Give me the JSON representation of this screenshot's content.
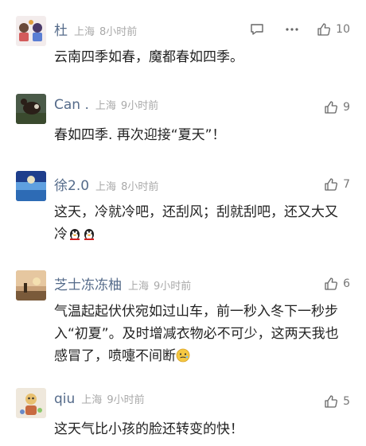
{
  "comments": [
    {
      "name": "杜",
      "location": "上海",
      "time": "8小时前",
      "likes": "10",
      "text": "云南四季如春，魔都春如四季。",
      "show_reply": true,
      "show_more": true
    },
    {
      "name": "Can .",
      "location": "上海",
      "time": "9小时前",
      "likes": "9",
      "text": "春如四季. 再次迎接“夏天”！"
    },
    {
      "name": "徐2.0",
      "location": "上海",
      "time": "8小时前",
      "likes": "7",
      "text": "这天，冷就冷吧，还刮风；刮就刮吧，还又大又冷"
    },
    {
      "name": "芝士冻冻柚",
      "location": "上海",
      "time": "9小时前",
      "likes": "6",
      "text": "气温起起伏伏宛如过山车，前一秒入冬下一秒步入“初夏”。及时增减衣物必不可少，这两天我也感冒了，喷嚏不间断"
    },
    {
      "name": "qiu",
      "location": "上海",
      "time": "9小时前",
      "likes": "5",
      "text": "这天气比小孩的脸还转变的快！"
    }
  ],
  "icons": {
    "reply": "comment-bubble-icon",
    "more": "more-dots-icon",
    "like": "thumbs-up-icon"
  },
  "colors": {
    "name": "#556b8a",
    "meta": "#a9a9a9",
    "text": "#222222"
  }
}
